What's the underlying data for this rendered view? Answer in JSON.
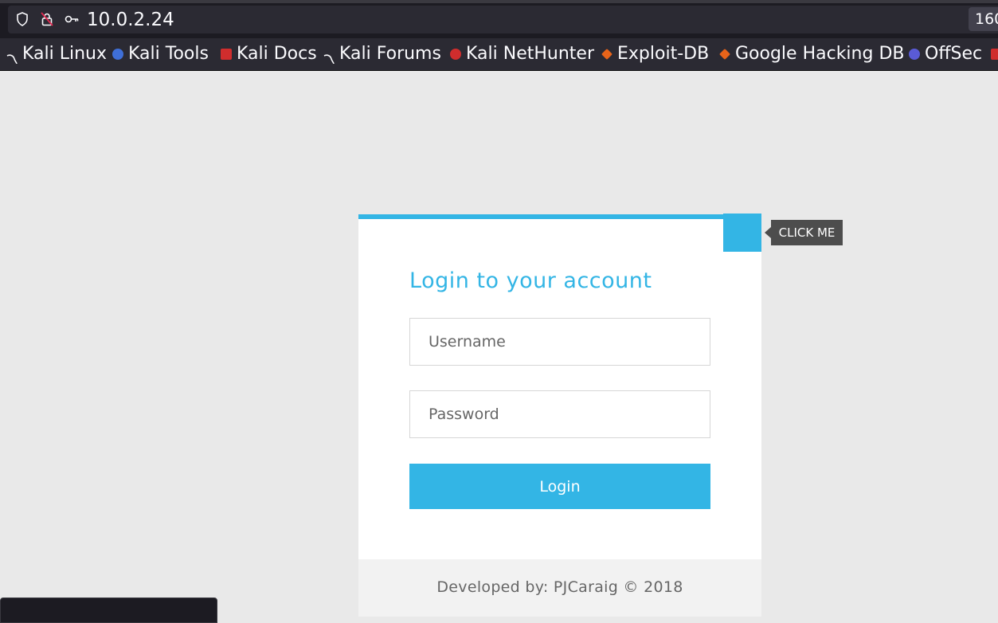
{
  "browser": {
    "url": "10.0.2.24",
    "zoom_label": "160",
    "bookmarks": [
      {
        "label": "Kali Linux",
        "icon": "kali-dragon-icon",
        "color": "#1c1b22"
      },
      {
        "label": "Kali Tools",
        "icon": "kali-tools-icon",
        "color": "#3f6fd8"
      },
      {
        "label": "Kali Docs",
        "icon": "kali-docs-icon",
        "color": "#d02d2d"
      },
      {
        "label": "Kali Forums",
        "icon": "kali-dragon-icon",
        "color": "#1c1b22"
      },
      {
        "label": "Kali NetHunter",
        "icon": "nethunter-icon",
        "color": "#d02d2d"
      },
      {
        "label": "Exploit-DB",
        "icon": "exploit-db-icon",
        "color": "#e8641a"
      },
      {
        "label": "Google Hacking DB",
        "icon": "ghdb-icon",
        "color": "#e8641a"
      },
      {
        "label": "OffSec",
        "icon": "offsec-icon",
        "color": "#5a5bd6"
      }
    ]
  },
  "login": {
    "title": "Login to your account",
    "username_placeholder": "Username",
    "password_placeholder": "Password",
    "submit_label": "Login",
    "tooltip": "CLICK ME",
    "footer": "Developed by: PJCaraig © 2018"
  },
  "colors": {
    "accent": "#33b5e5",
    "page_bg": "#e9e9e9",
    "tooltip_bg": "#4d4d4d"
  }
}
